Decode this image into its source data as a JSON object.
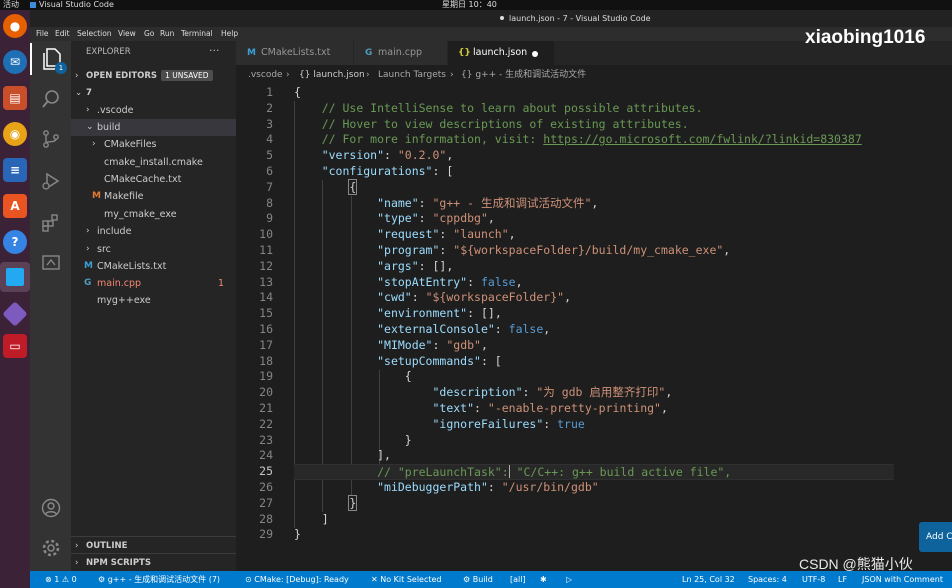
{
  "system": {
    "activities": "活动",
    "app_name": "Visual Studio Code",
    "clock": "星期日 10：40"
  },
  "window_title": "launch.json - 7 - Visual Studio Code",
  "menu": [
    "File",
    "Edit",
    "Selection",
    "View",
    "Go",
    "Run",
    "Terminal",
    "Help"
  ],
  "activity_badge": "1",
  "sidebar": {
    "title": "EXPLORER",
    "more": "···",
    "open_editors": "OPEN EDITORS",
    "unsaved": "1 UNSAVED",
    "folder": "7",
    "tree": [
      {
        "name": ".vscode",
        "chev": "›"
      },
      {
        "name": "build",
        "chev": "⌄"
      },
      {
        "name": "CMakeFiles",
        "chev": "›"
      },
      {
        "name": "cmake_install.cmake"
      },
      {
        "name": "CMakeCache.txt"
      },
      {
        "name": "Makefile",
        "icon": "M"
      },
      {
        "name": "my_cmake_exe"
      },
      {
        "name": "include",
        "chev": "›"
      },
      {
        "name": "src",
        "chev": "›"
      },
      {
        "name": "CMakeLists.txt",
        "icon": "M"
      },
      {
        "name": "main.cpp",
        "icon": "G",
        "count": "1"
      },
      {
        "name": "myg++exe"
      }
    ],
    "outline": "OUTLINE",
    "npm": "NPM SCRIPTS"
  },
  "tabs": [
    {
      "label": "CMakeLists.txt",
      "icon": "M"
    },
    {
      "label": "main.cpp",
      "icon": "G"
    },
    {
      "label": "launch.json",
      "icon": "{}"
    }
  ],
  "watermark": "xiaobing1016",
  "breadcrumb": [
    ".vscode",
    "{} launch.json",
    "Launch Targets",
    "{} g++ - 生成和调试活动文件"
  ],
  "code": {
    "l1": "{",
    "l2": "// Use IntelliSense to learn about possible attributes.",
    "l3": "// Hover to view descriptions of existing attributes.",
    "l4a": "// For more information, visit: ",
    "l4b": "https://go.microsoft.com/fwlink/?linkid=830387",
    "version_k": "\"version\"",
    "version_v": "\"0.2.0\"",
    "configurations_k": "\"configurations\"",
    "name_k": "\"name\"",
    "name_v": "\"g++ - 生成和调试活动文件\"",
    "type_k": "\"type\"",
    "type_v": "\"cppdbg\"",
    "request_k": "\"request\"",
    "request_v": "\"launch\"",
    "program_k": "\"program\"",
    "program_v": "\"${workspaceFolder}/build/my_cmake_exe\"",
    "args_k": "\"args\"",
    "args_v": "[]",
    "stop_k": "\"stopAtEntry\"",
    "stop_v": "false",
    "cwd_k": "\"cwd\"",
    "cwd_v": "\"${workspaceFolder}\"",
    "env_k": "\"environment\"",
    "env_v": "[]",
    "ext_k": "\"externalConsole\"",
    "ext_v": "false",
    "mimode_k": "\"MIMode\"",
    "mimode_v": "\"gdb\"",
    "setup_k": "\"setupCommands\"",
    "desc_k": "\"description\"",
    "desc_v": "\"为 gdb 启用整齐打印\"",
    "text_k": "\"text\"",
    "text_v": "\"-enable-pretty-printing\"",
    "ign_k": "\"ignoreFailures\"",
    "ign_v": "true",
    "l25a": "// \"preLaunchTask\":",
    "l25b": " \"C/C++: g++ build active file\",",
    "dbg_k": "\"miDebuggerPath\"",
    "dbg_v": "\"/usr/bin/gdb\""
  },
  "add_button": "Add C",
  "status": {
    "problems": "⊗ 1 ⚠ 0",
    "config": "g++ - 生成和调试活动文件 (7)",
    "cmake": "CMake: [Debug]: Ready",
    "kit": "No Kit Selected",
    "build": "Build",
    "all": "[all]",
    "pos": "Ln 25, Col 32",
    "spaces": "Spaces: 4",
    "enc": "UTF-8",
    "eol": "LF",
    "lang": "JSON with Comment"
  },
  "csdn_watermark": "CSDN @熊猫小伙"
}
